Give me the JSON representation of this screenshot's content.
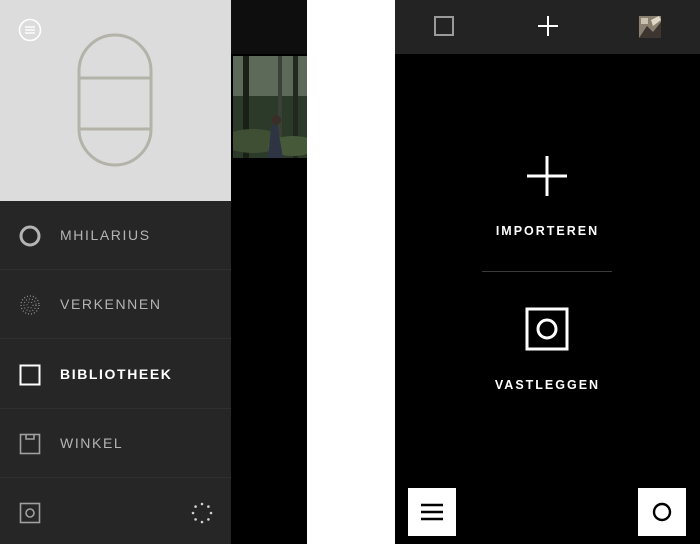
{
  "left_screen": {
    "drawer": {
      "menu_icon": "menu-lines-circle-icon",
      "profile_avatar_icon": "capsule-avatar-icon",
      "nav_items": [
        {
          "label": "MHILARIUS",
          "icon": "circle-icon",
          "active": false
        },
        {
          "label": "VERKENNEN",
          "icon": "dotted-circle-icon",
          "active": false
        },
        {
          "label": "BIBLIOTHEEK",
          "icon": "square-icon",
          "active": true
        },
        {
          "label": "WINKEL",
          "icon": "shop-box-icon",
          "active": false
        }
      ],
      "bottom_icons": [
        "capture-square-icon",
        "loading-dots-icon"
      ]
    },
    "background": {
      "photo": "forest-photo-thumbnail"
    }
  },
  "right_screen": {
    "top_bar": {
      "icons": [
        "square-icon",
        "plus-icon",
        "photo-thumbnail"
      ]
    },
    "actions": {
      "import_label": "IMPORTEREN",
      "capture_label": "VASTLEGGEN"
    },
    "bottom_buttons": {
      "menu_icon": "hamburger-menu-icon",
      "capture_icon": "circle-icon"
    }
  },
  "colors": {
    "drawer_bg": "#262626",
    "profile_bg": "#dcdcdc",
    "screen_bg": "#000000",
    "top_bar_bg": "#232323",
    "text_inactive": "#b4b4b4",
    "text_active": "#ffffff"
  }
}
